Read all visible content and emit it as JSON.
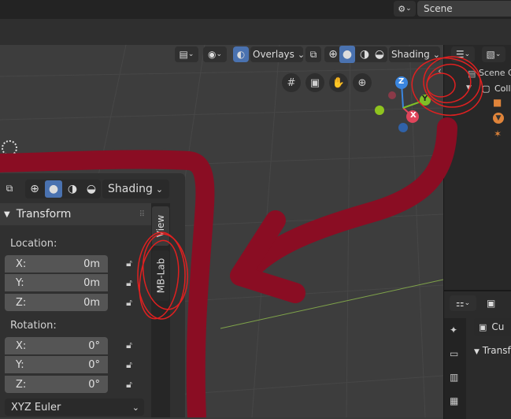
{
  "topbar": {
    "scene_label": "Scene"
  },
  "viewport_header": {
    "overlays_label": "Overlays",
    "shading_label": "Shading"
  },
  "outliner": {
    "title": "Scene C",
    "collection": "Colle"
  },
  "npanel": {
    "shading_label": "Shading",
    "transform_title": "Transform",
    "location_label": "Location:",
    "location": [
      {
        "axis": "X:",
        "value": "0m"
      },
      {
        "axis": "Y:",
        "value": "0m"
      },
      {
        "axis": "Z:",
        "value": "0m"
      }
    ],
    "rotation_label": "Rotation:",
    "rotation": [
      {
        "axis": "X:",
        "value": "0°"
      },
      {
        "axis": "Y:",
        "value": "0°"
      },
      {
        "axis": "Z:",
        "value": "0°"
      }
    ],
    "rotation_mode": "XYZ Euler",
    "tabs": [
      "View",
      "MB-Lab"
    ]
  },
  "props": {
    "object_label": "Cu",
    "section": "Transf"
  },
  "gizmo": {
    "z": "Z",
    "x": "X",
    "y": "Y"
  },
  "colors": {
    "annotation": "#8a0d23",
    "circle": "#e02020",
    "x_axis": "#e0455b",
    "y_axis": "#7fbf26",
    "z_axis": "#3a86e0"
  }
}
